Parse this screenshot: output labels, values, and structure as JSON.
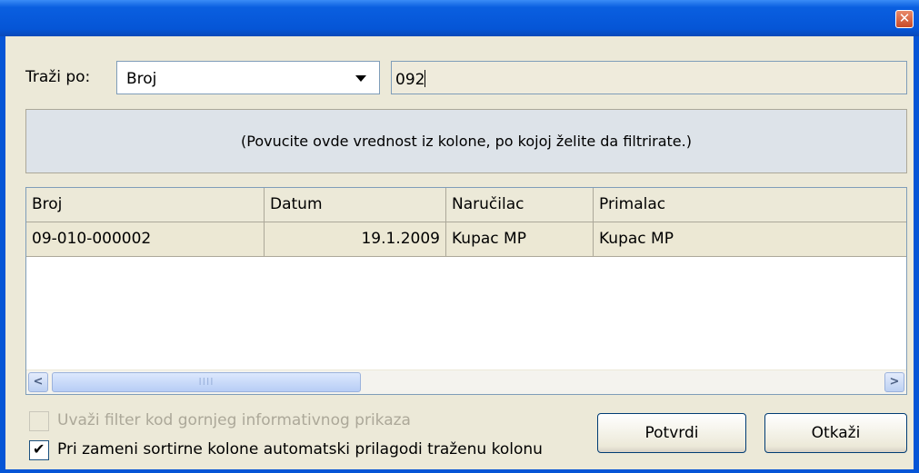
{
  "window": {
    "close_glyph": "✕"
  },
  "search": {
    "label": "Traži po:",
    "field_selected": "Broj",
    "value": "092"
  },
  "group_panel": {
    "hint": "(Povucite ovde vrednost iz kolone, po kojoj želite da filtrirate.)"
  },
  "grid": {
    "columns": [
      "Broj",
      "Datum",
      "Naručilac",
      "Primalac"
    ],
    "rows": [
      [
        "09-010-000002",
        "19.1.2009",
        "Kupac MP",
        "Kupac MP"
      ]
    ],
    "scrollbar": {
      "left_arrow": "<",
      "right_arrow": ">",
      "thumb_grip": "IIII"
    }
  },
  "options": {
    "apply_filter_label": "Uvaži filter kod gornjeg informativnog prikaza",
    "apply_filter_checked": false,
    "apply_filter_enabled": false,
    "auto_adjust_label": "Pri zameni sortirne kolone automatski prilagodi traženu kolonu",
    "auto_adjust_checked": true,
    "check_glyph": "✔"
  },
  "buttons": {
    "confirm": "Potvrdi",
    "cancel": "Otkaži"
  },
  "colors": {
    "title_bar": "#0555d6",
    "group_panel": "#dde3e9",
    "selected_row": "#ece8d4"
  }
}
